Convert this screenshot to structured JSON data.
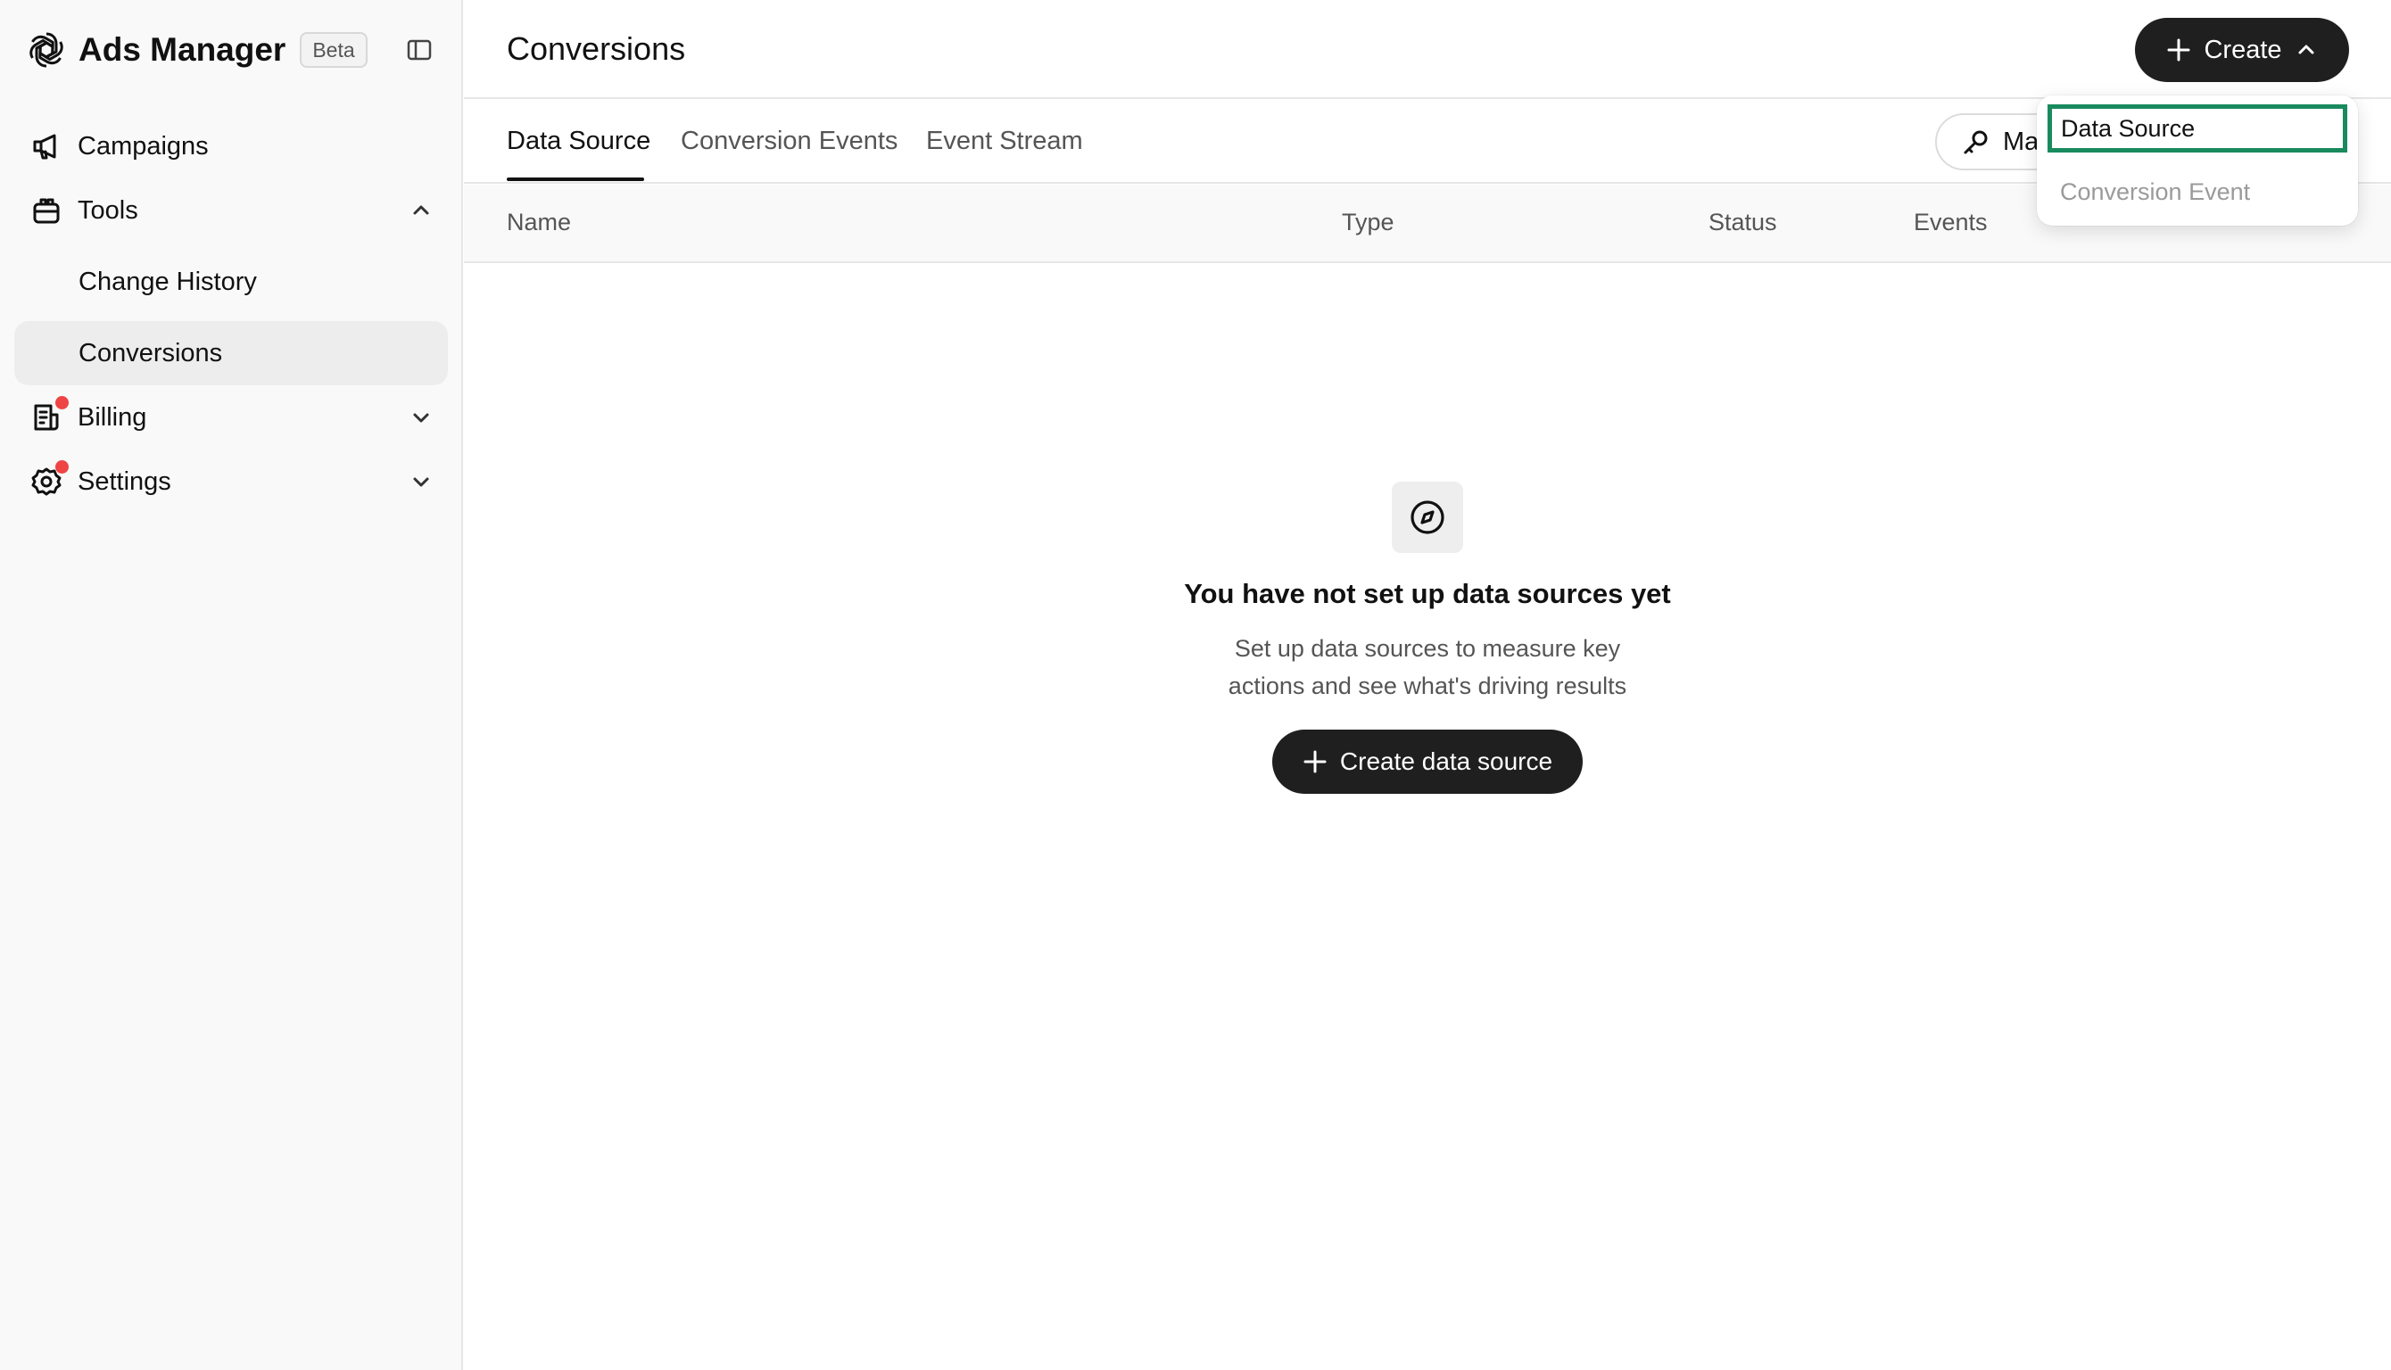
{
  "app": {
    "name": "Ads Manager",
    "badge": "Beta"
  },
  "sidebar": {
    "items": [
      {
        "label": "Campaigns",
        "icon": "megaphone-icon"
      },
      {
        "label": "Tools",
        "icon": "toolbox-icon",
        "expanded": true,
        "children": [
          {
            "label": "Change History"
          },
          {
            "label": "Conversions",
            "active": true
          }
        ]
      },
      {
        "label": "Billing",
        "icon": "receipt-icon",
        "notification": true
      },
      {
        "label": "Settings",
        "icon": "gear-icon",
        "notification": true
      }
    ]
  },
  "header": {
    "title": "Conversions",
    "create_label": "Create"
  },
  "tabs": [
    {
      "label": "Data Source",
      "active": true
    },
    {
      "label": "Conversion Events"
    },
    {
      "label": "Event Stream"
    }
  ],
  "manage_button": {
    "label": "Ma"
  },
  "table": {
    "columns": [
      "Name",
      "Type",
      "Status",
      "Events"
    ]
  },
  "empty_state": {
    "icon": "compass-icon",
    "title": "You have not set up data sources yet",
    "description_line1": "Set up data sources to measure key",
    "description_line2": "actions and see what's driving results",
    "cta_label": "Create data source"
  },
  "dropdown": {
    "items": [
      {
        "label": "Data Source",
        "selected": true
      },
      {
        "label": "Conversion Event",
        "disabled": true
      }
    ]
  },
  "colors": {
    "primary_button": "#1f1f1f",
    "highlight": "#198a5e",
    "notification": "#ef4444",
    "sidebar_bg": "#f9f9f9"
  }
}
